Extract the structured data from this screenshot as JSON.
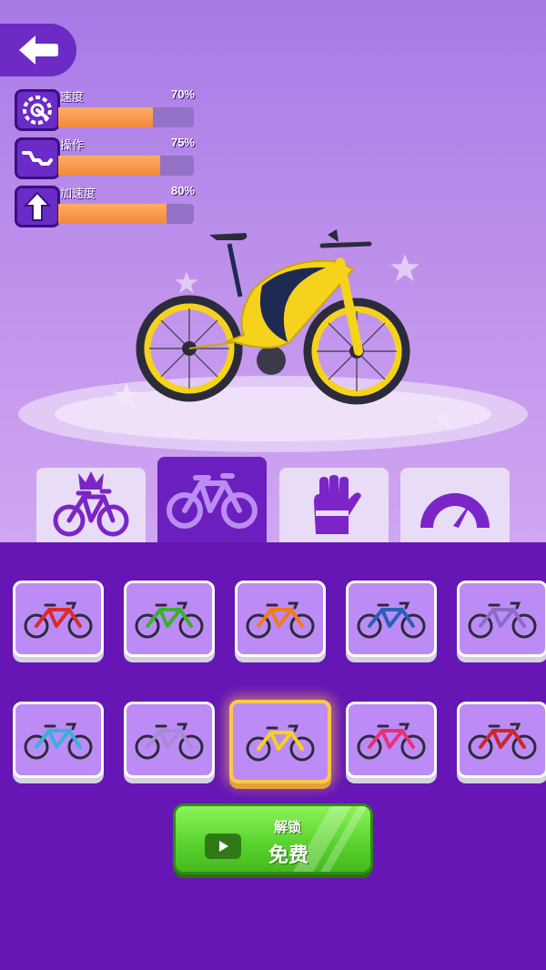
{
  "stats": [
    {
      "label": "速度",
      "value": "70%",
      "level": 0.7,
      "icon": "speedometer-icon"
    },
    {
      "label": "操作",
      "value": "75%",
      "level": 0.75,
      "icon": "handling-icon"
    },
    {
      "label": "加速度",
      "value": "80%",
      "level": 0.8,
      "icon": "arrow-up-icon"
    }
  ],
  "tabs": [
    {
      "icon": "crown-bike-icon",
      "active": false
    },
    {
      "icon": "bike-icon",
      "active": true
    },
    {
      "icon": "glove-icon",
      "active": false
    },
    {
      "icon": "gauge-icon",
      "active": false
    }
  ],
  "bikes": [
    {
      "color": "#d92b2b",
      "selected": false
    },
    {
      "color": "#38b02f",
      "selected": false
    },
    {
      "color": "#f07a1e",
      "selected": false
    },
    {
      "color": "#2a5fb8",
      "selected": false
    },
    {
      "color": "#8a6cc7",
      "selected": false
    },
    {
      "color": "#3ab0d9",
      "selected": false
    },
    {
      "color": "#a58bd6",
      "selected": false
    },
    {
      "color": "#f5d21c",
      "selected": true
    },
    {
      "color": "#e6317a",
      "selected": false
    },
    {
      "color": "#c8282e",
      "selected": false
    }
  ],
  "unlock": {
    "title": "解锁",
    "price": "免费"
  },
  "colors": {
    "accent": "#6516b5",
    "button_green": "#5bd42f",
    "selected_border": "#ffc84a",
    "hero_bike": "#f5d21c"
  }
}
